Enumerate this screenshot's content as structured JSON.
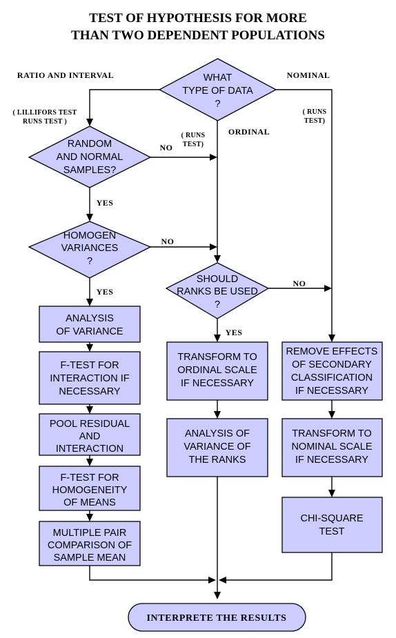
{
  "title": {
    "line1": "TEST OF HYPOTHESIS FOR MORE",
    "line2": "THAN TWO DEPENDENT POPULATIONS"
  },
  "nodes": {
    "what_type_of_data": {
      "line1": "WHAT",
      "line2": "TYPE OF DATA",
      "line3": "?"
    },
    "random_and_normal": {
      "line1": "RANDOM",
      "line2": "AND NORMAL",
      "line3": "SAMPLES?"
    },
    "homogen_variances": {
      "line1": "HOMOGEN",
      "line2": "VARIANCES",
      "line3": "?"
    },
    "should_ranks_be_used": {
      "line1": "SHOULD",
      "line2": "RANKS BE USED",
      "line3": "?"
    },
    "analysis_of_variance": {
      "line1": "ANALYSIS",
      "line2": "OF VARIANCE"
    },
    "f_test_interaction": {
      "line1": "F-TEST FOR",
      "line2": "INTERACTION IF",
      "line3": "NECESSARY"
    },
    "pool_residual": {
      "line1": "POOL RESIDUAL",
      "line2": "AND",
      "line3": "INTERACTION"
    },
    "f_test_homogeneity": {
      "line1": "F-TEST FOR",
      "line2": "HOMOGENEITY",
      "line3": "OF MEANS"
    },
    "multiple_pair": {
      "line1": "MULTIPLE PAIR",
      "line2": "COMPARISON OF",
      "line3": "SAMPLE MEAN"
    },
    "transform_ordinal": {
      "line1": "TRANSFORM TO",
      "line2": "ORDINAL SCALE",
      "line3": "IF NECESSARY"
    },
    "analysis_variance_ranks": {
      "line1": "ANALYSIS OF",
      "line2": "VARIANCE OF",
      "line3": "THE RANKS"
    },
    "remove_effects": {
      "line1": "REMOVE EFFECTS",
      "line2": "OF SECONDARY",
      "line3": "CLASSIFICATION",
      "line4": "IF NECESSARY"
    },
    "transform_nominal": {
      "line1": "TRANSFORM TO",
      "line2": "NOMINAL SCALE",
      "line3": "IF NECESSARY"
    },
    "chi_square_test": {
      "line1": "CHI-SQUARE",
      "line2": "TEST"
    },
    "interprete_results": {
      "label": "INTERPRETE THE RESULTS"
    }
  },
  "edge_labels": {
    "ratio_and_interval": "RATIO AND INTERVAL",
    "nominal": "NOMINAL",
    "ordinal": "ORDINAL",
    "lillifors_test_l1": "( LILLIFORS TEST",
    "lillifors_test_l2": "RUNS TEST )",
    "runs_test_mid_l1": "( RUNS",
    "runs_test_mid_l2": "TEST)",
    "runs_test_right_l1": "( RUNS",
    "runs_test_right_l2": "TEST)",
    "no_random": "NO",
    "yes_random": "YES",
    "no_homogen": "NO",
    "yes_homogen": "YES",
    "no_ranks": "NO",
    "yes_ranks": "YES"
  },
  "colors": {
    "shape_fill": "#ccccff",
    "stroke": "#000000",
    "background": "#ffffff"
  }
}
